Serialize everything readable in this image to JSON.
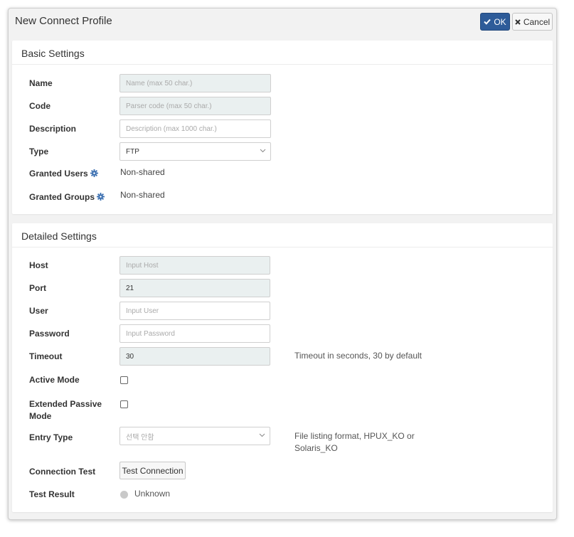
{
  "dialog": {
    "title": "New Connect Profile",
    "ok_label": "OK",
    "cancel_label": "Cancel"
  },
  "basic": {
    "title": "Basic Settings",
    "name": {
      "label": "Name",
      "placeholder": "Name (max 50 char.)"
    },
    "code": {
      "label": "Code",
      "placeholder": "Parser code (max 50 char.)"
    },
    "description": {
      "label": "Description",
      "placeholder": "Description (max 1000 char.)"
    },
    "type": {
      "label": "Type",
      "value": "FTP"
    },
    "granted_users": {
      "label": "Granted Users",
      "value": "Non-shared"
    },
    "granted_groups": {
      "label": "Granted Groups",
      "value": "Non-shared"
    }
  },
  "detailed": {
    "title": "Detailed Settings",
    "host": {
      "label": "Host",
      "placeholder": "Input Host"
    },
    "port": {
      "label": "Port",
      "value": "21"
    },
    "user": {
      "label": "User",
      "placeholder": "Input User"
    },
    "password": {
      "label": "Password",
      "placeholder": "Input Password"
    },
    "timeout": {
      "label": "Timeout",
      "value": "30",
      "help": "Timeout in seconds, 30 by default"
    },
    "active_mode": {
      "label": "Active Mode",
      "checked": false
    },
    "extended_passive": {
      "label_line1": "Extended Passive",
      "label_line2": "Mode",
      "checked": false
    },
    "entry_type": {
      "label": "Entry Type",
      "placeholder": "선택 안함",
      "help_line1": "File listing format, HPUX_KO or",
      "help_line2": "Solaris_KO"
    },
    "connection_test": {
      "label": "Connection Test",
      "button_label": "Test Connection"
    },
    "test_result": {
      "label": "Test Result",
      "value": "Unknown"
    }
  },
  "icons": {
    "ok": "check-icon",
    "cancel": "close-icon",
    "gear": "gear-icon",
    "select": "chevron-down-icon"
  },
  "colors": {
    "primary": "#2e5c99",
    "gear": "#3a6fb0",
    "shaded_input": "#eaf0f0",
    "status_unknown": "#c9c9c9"
  }
}
